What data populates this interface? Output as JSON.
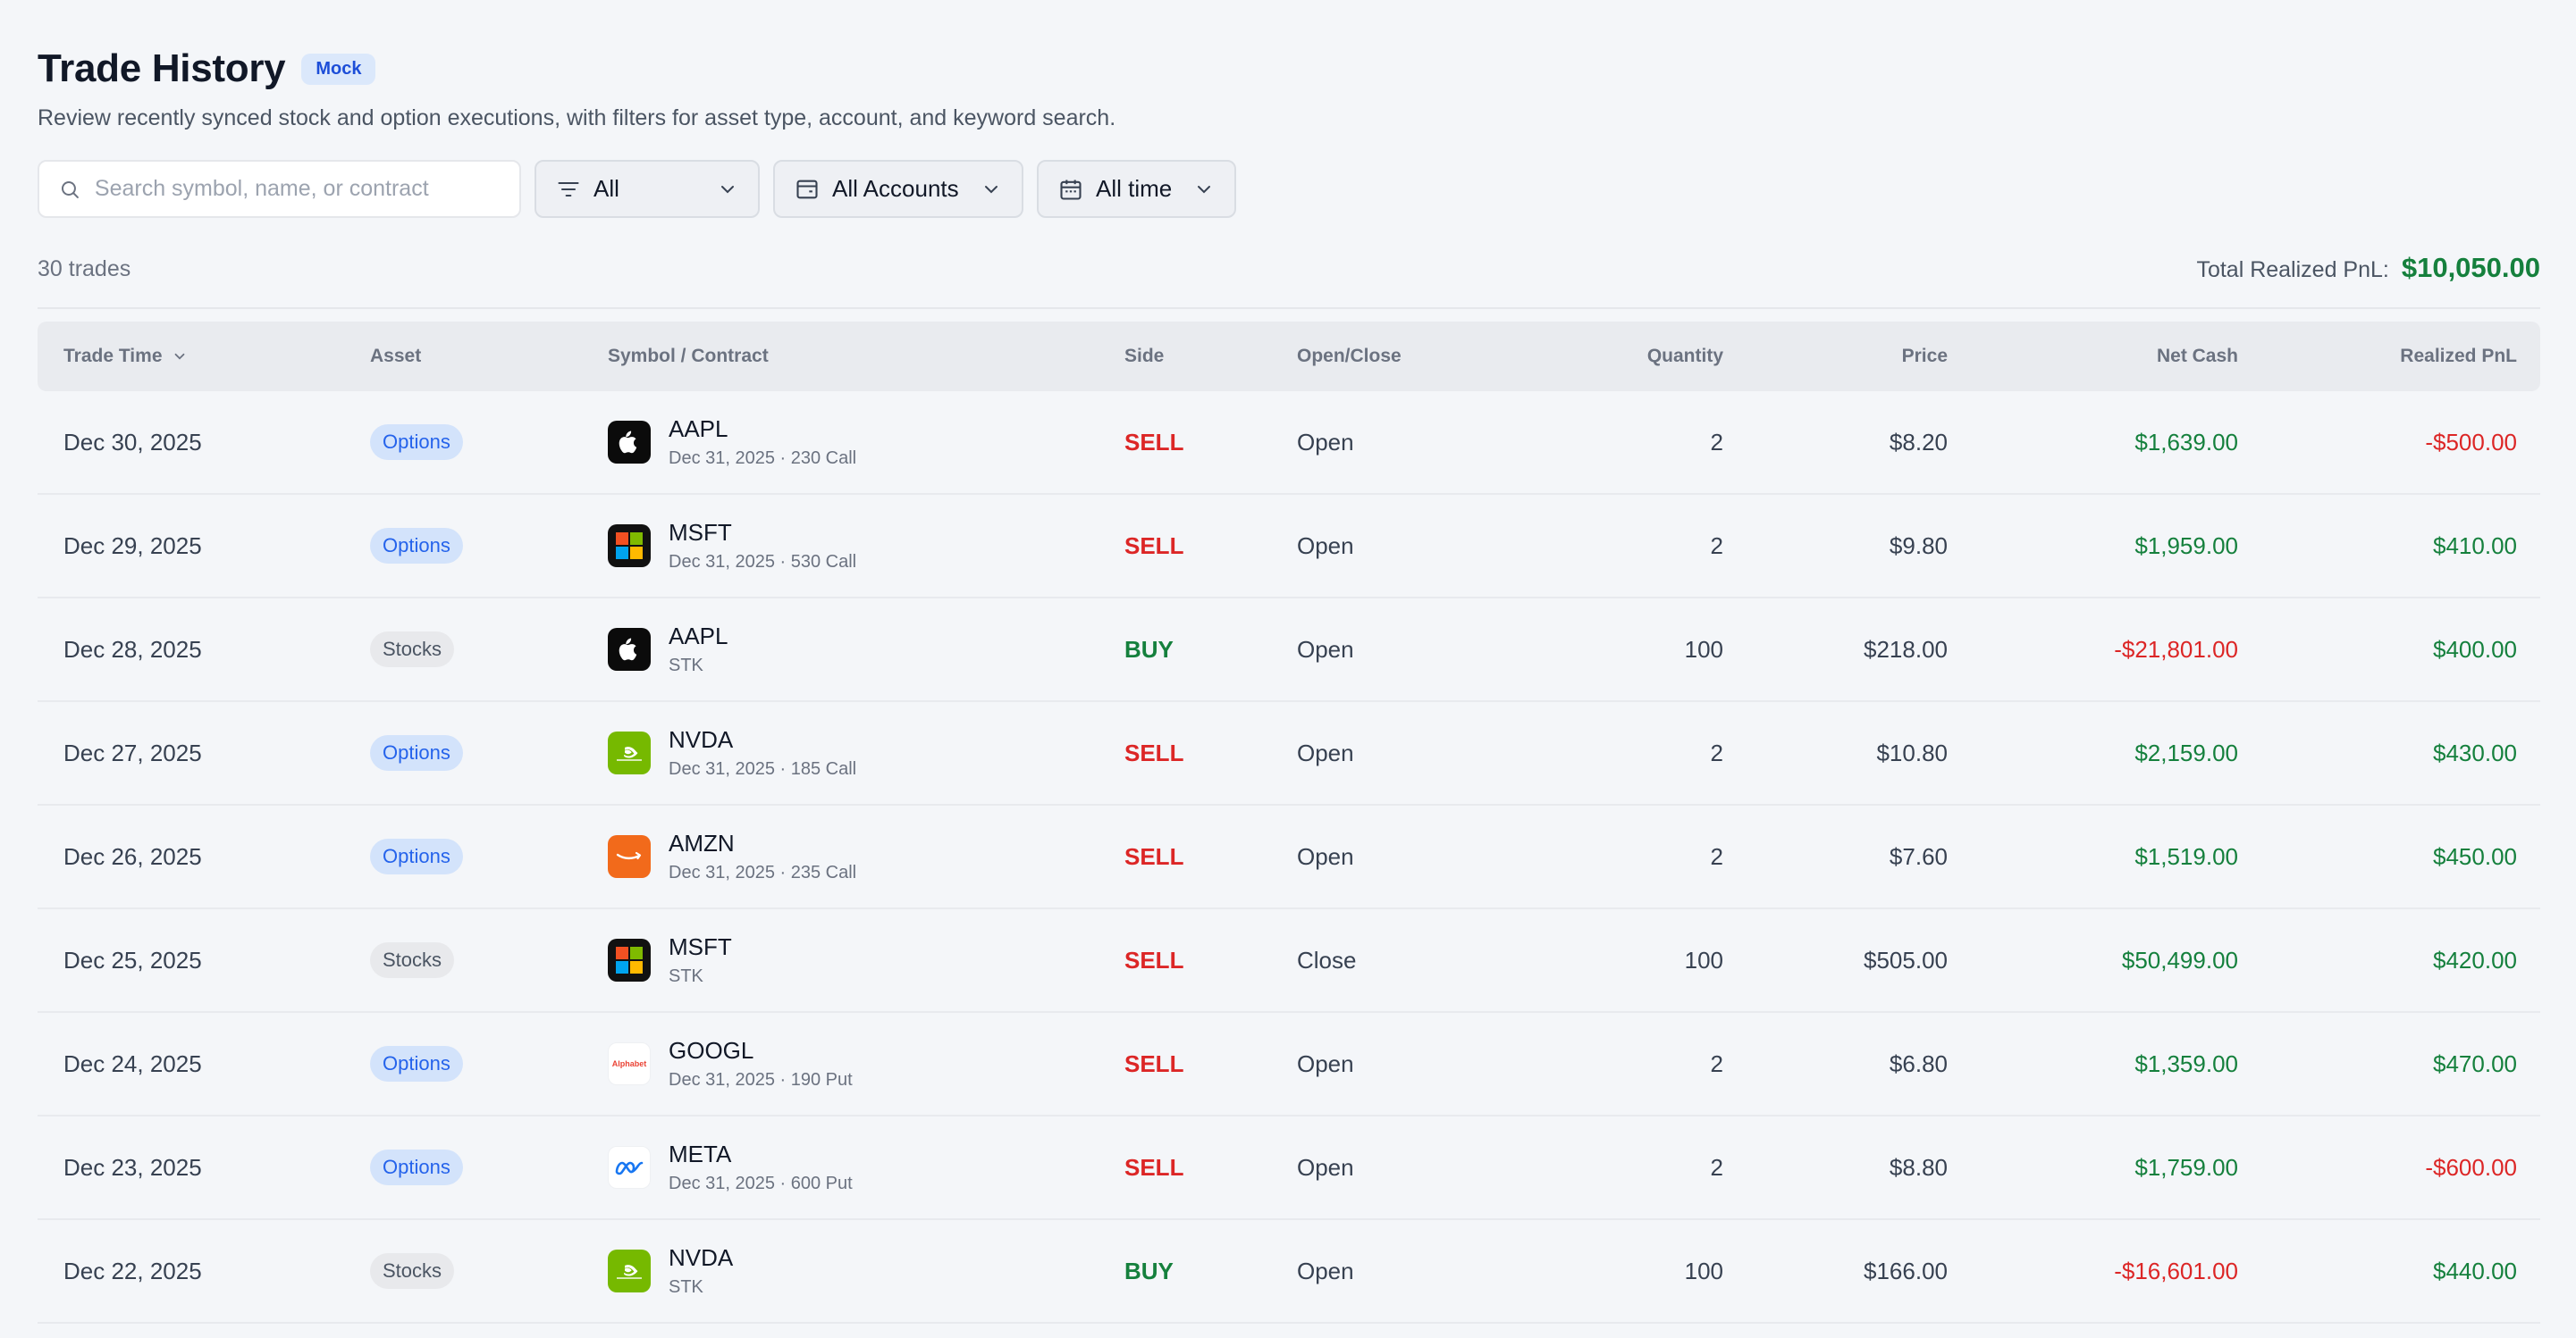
{
  "header": {
    "title": "Trade History",
    "badge": "Mock",
    "subtitle": "Review recently synced stock and option executions, with filters for asset type, account, and keyword search."
  },
  "filters": {
    "search_placeholder": "Search symbol, name, or contract",
    "search_value": "",
    "asset_type": "All",
    "account": "All Accounts",
    "time_range": "All time"
  },
  "summary": {
    "trade_count": "30 trades",
    "total_pnl_label": "Total Realized PnL:",
    "total_pnl_value": "$10,050.00"
  },
  "table": {
    "columns": [
      "Trade Time",
      "Asset",
      "Symbol / Contract",
      "Side",
      "Open/Close",
      "Quantity",
      "Price",
      "Net Cash",
      "Realized PnL"
    ],
    "rows": [
      {
        "time": "Dec 30, 2025",
        "asset": "Options",
        "symbol": "AAPL",
        "logo": "apple-icon",
        "contract": "Dec 31, 2025 · 230 Call",
        "side": "SELL",
        "oc": "Open",
        "qty": "2",
        "price": "$8.20",
        "net": "$1,639.00",
        "pnl": "-$500.00"
      },
      {
        "time": "Dec 29, 2025",
        "asset": "Options",
        "symbol": "MSFT",
        "logo": "microsoft-icon",
        "contract": "Dec 31, 2025 · 530 Call",
        "side": "SELL",
        "oc": "Open",
        "qty": "2",
        "price": "$9.80",
        "net": "$1,959.00",
        "pnl": "$410.00"
      },
      {
        "time": "Dec 28, 2025",
        "asset": "Stocks",
        "symbol": "AAPL",
        "logo": "apple-icon",
        "contract": "STK",
        "side": "BUY",
        "oc": "Open",
        "qty": "100",
        "price": "$218.00",
        "net": "-$21,801.00",
        "pnl": "$400.00"
      },
      {
        "time": "Dec 27, 2025",
        "asset": "Options",
        "symbol": "NVDA",
        "logo": "nvidia-icon",
        "contract": "Dec 31, 2025 · 185 Call",
        "side": "SELL",
        "oc": "Open",
        "qty": "2",
        "price": "$10.80",
        "net": "$2,159.00",
        "pnl": "$430.00"
      },
      {
        "time": "Dec 26, 2025",
        "asset": "Options",
        "symbol": "AMZN",
        "logo": "amazon-icon",
        "contract": "Dec 31, 2025 · 235 Call",
        "side": "SELL",
        "oc": "Open",
        "qty": "2",
        "price": "$7.60",
        "net": "$1,519.00",
        "pnl": "$450.00"
      },
      {
        "time": "Dec 25, 2025",
        "asset": "Stocks",
        "symbol": "MSFT",
        "logo": "microsoft-icon",
        "contract": "STK",
        "side": "SELL",
        "oc": "Close",
        "qty": "100",
        "price": "$505.00",
        "net": "$50,499.00",
        "pnl": "$420.00"
      },
      {
        "time": "Dec 24, 2025",
        "asset": "Options",
        "symbol": "GOOGL",
        "logo": "alphabet-icon",
        "contract": "Dec 31, 2025 · 190 Put",
        "side": "SELL",
        "oc": "Open",
        "qty": "2",
        "price": "$6.80",
        "net": "$1,359.00",
        "pnl": "$470.00"
      },
      {
        "time": "Dec 23, 2025",
        "asset": "Options",
        "symbol": "META",
        "logo": "meta-icon",
        "contract": "Dec 31, 2025 · 600 Put",
        "side": "SELL",
        "oc": "Open",
        "qty": "2",
        "price": "$8.80",
        "net": "$1,759.00",
        "pnl": "-$600.00"
      },
      {
        "time": "Dec 22, 2025",
        "asset": "Stocks",
        "symbol": "NVDA",
        "logo": "nvidia-icon",
        "contract": "STK",
        "side": "BUY",
        "oc": "Open",
        "qty": "100",
        "price": "$166.00",
        "net": "-$16,601.00",
        "pnl": "$440.00"
      }
    ],
    "alphabet_logo_text": "Alphabet"
  },
  "colors": {
    "positive": "#15803d",
    "negative": "#dc2626",
    "options_badge": "#d3e3fb",
    "stocks_badge": "#e8e9ec"
  }
}
